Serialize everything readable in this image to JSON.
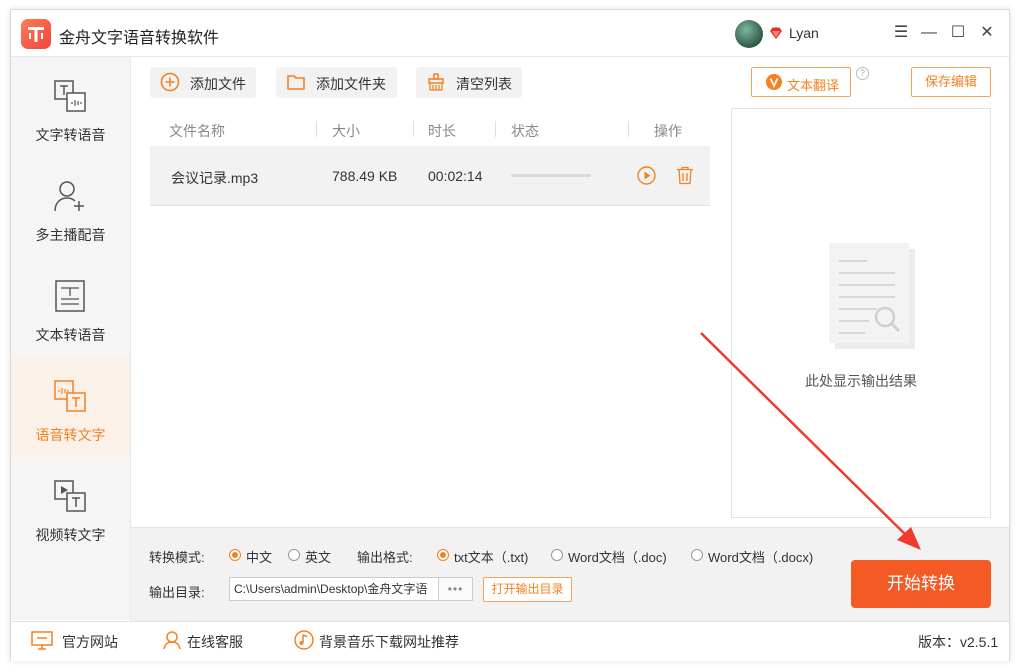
{
  "app": {
    "title": "金舟文字语音转换软件"
  },
  "user": {
    "name": "Lyan"
  },
  "window_controls": {
    "menu": "☰",
    "minimize": "—",
    "maximize": "☐",
    "close": "✕"
  },
  "sidebar": {
    "items": [
      {
        "label": "文字转语音",
        "icon": "text-to-speech-icon"
      },
      {
        "label": "多主播配音",
        "icon": "add-user-icon"
      },
      {
        "label": "文本转语音",
        "icon": "document-text-icon"
      },
      {
        "label": "语音转文字",
        "icon": "speech-to-text-icon",
        "active": true
      },
      {
        "label": "视频转文字",
        "icon": "video-to-text-icon"
      }
    ]
  },
  "toolbar": {
    "add_file": "添加文件",
    "add_folder": "添加文件夹",
    "clear_list": "清空列表",
    "translate": "文本翻译",
    "save_edit": "保存编辑"
  },
  "file_table": {
    "columns": [
      "文件名称",
      "大小",
      "时长",
      "状态",
      "操作"
    ],
    "rows": [
      {
        "name": "会议记录.mp3",
        "size": "788.49 KB",
        "duration": "00:02:14",
        "progress": 0
      }
    ]
  },
  "result_panel": {
    "placeholder": "此处显示输出结果"
  },
  "settings": {
    "mode_label": "转换模式:",
    "mode_options": [
      "中文",
      "英文"
    ],
    "mode_selected": "中文",
    "format_label": "输出格式:",
    "format_options": [
      "txt文本（.txt)",
      "Word文档（.doc)",
      "Word文档（.docx)"
    ],
    "format_selected": "txt文本（.txt)",
    "output_label": "输出目录:",
    "output_path": "C:\\Users\\admin\\Desktop\\金舟文字语",
    "browse": "•••",
    "open_dir": "打开输出目录",
    "start": "开始转换"
  },
  "statusbar": {
    "website": "官方网站",
    "support": "在线客服",
    "music": "背景音乐下载网址推荐",
    "version": "版本：v2.5.1"
  },
  "colors": {
    "accent": "#f58120",
    "start_button": "#f35a24",
    "arrow": "#f03a2e"
  }
}
